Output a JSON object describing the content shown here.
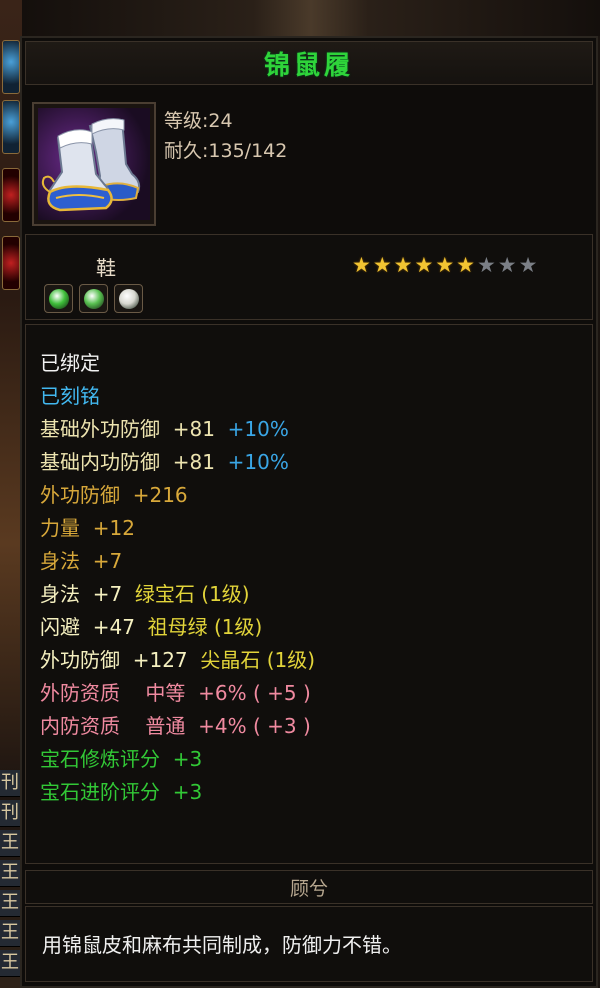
{
  "background": {
    "side_chars": [
      "刊",
      "刊",
      "王",
      "王",
      "王",
      "王",
      "王"
    ]
  },
  "item": {
    "name": "锦鼠履",
    "level_label": "等级:24",
    "durability_label": "耐久:135/142",
    "type": "鞋",
    "stars_filled": 6,
    "stars_total": 9,
    "gem_slots": [
      {
        "icon": "green-gem-icon",
        "color": "#3fbf3a"
      },
      {
        "icon": "leaf-gem-icon",
        "color": "#58c050"
      },
      {
        "icon": "rune-gem-icon",
        "color": "#d8d8d0"
      }
    ]
  },
  "attributes": [
    {
      "parts": [
        {
          "text": "已绑定",
          "color": "#f2f2f2"
        }
      ]
    },
    {
      "parts": [
        {
          "text": "已刻铭",
          "color": "#42b8f0"
        }
      ]
    },
    {
      "parts": [
        {
          "text": "基础外功防御  +81",
          "color": "#ede4b0"
        },
        {
          "text": "  +10%",
          "color": "#3aa6e6"
        }
      ]
    },
    {
      "parts": [
        {
          "text": "基础内功防御  +81",
          "color": "#ede4b0"
        },
        {
          "text": "  +10%",
          "color": "#3aa6e6"
        }
      ]
    },
    {
      "parts": [
        {
          "text": "外功防御  +216",
          "color": "#d8a83a"
        }
      ]
    },
    {
      "parts": [
        {
          "text": "力量  +12",
          "color": "#d8a83a"
        }
      ]
    },
    {
      "parts": [
        {
          "text": "身法  +7",
          "color": "#d8a83a"
        }
      ]
    },
    {
      "parts": [
        {
          "text": "身法  +7  ",
          "color": "#f5f0c0"
        },
        {
          "text": "绿宝石 (1级)",
          "color": "#e2d43a"
        }
      ]
    },
    {
      "parts": [
        {
          "text": "闪避  +47  ",
          "color": "#f5f0c0"
        },
        {
          "text": "祖母绿 (1级)",
          "color": "#e2d43a"
        }
      ]
    },
    {
      "parts": [
        {
          "text": "外功防御  +127  ",
          "color": "#f5f0c0"
        },
        {
          "text": "尖晶石 (1级)",
          "color": "#e2d43a"
        }
      ]
    },
    {
      "parts": [
        {
          "text": "外防资质    中等  +6% ( +5 )",
          "color": "#f08aa0"
        }
      ]
    },
    {
      "parts": [
        {
          "text": "内防资质    普通  +4% ( +3 )",
          "color": "#f08aa0"
        }
      ]
    },
    {
      "parts": [
        {
          "text": "宝石修炼评分  +3",
          "color": "#32c836"
        }
      ]
    },
    {
      "parts": [
        {
          "text": "宝石进阶评分  +3",
          "color": "#32c836"
        }
      ]
    }
  ],
  "footer": {
    "title": "顾兮",
    "description": "用锦鼠皮和麻布共同制成，防御力不错。"
  }
}
